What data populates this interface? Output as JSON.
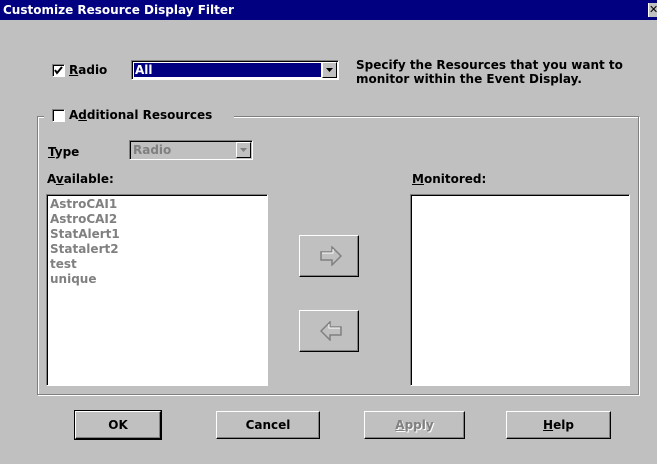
{
  "window": {
    "title": "Customize Resource Display Filter",
    "close_glyph": "✕"
  },
  "filter": {
    "radio_checkbox_checked": true,
    "radio_label_mnemonic": "R",
    "radio_label_rest": "adio",
    "radio_combo_value": "All",
    "instruction_line1": "Specify the Resources that you want to",
    "instruction_line2": "monitor within the Event Display."
  },
  "additional": {
    "checkbox_checked": false,
    "label_pre": "A",
    "label_mnemonic": "d",
    "label_rest": "ditional Resources",
    "type_label_mnemonic": "T",
    "type_label_rest": "ype",
    "type_value": "Radio",
    "available_label_pre": "A",
    "available_label_mnemonic": "v",
    "available_label_rest": "ailable:",
    "monitored_label_mnemonic": "M",
    "monitored_label_rest": "onitored:",
    "available_items": [
      "AstroCAI1",
      "AstroCAI2",
      "StatAlert1",
      "Statalert2",
      "test",
      "unique"
    ],
    "monitored_items": [],
    "add_icon": "right-arrow-icon",
    "remove_icon": "left-arrow-icon"
  },
  "buttons": {
    "ok": "OK",
    "cancel": "Cancel",
    "apply_mnemonic": "A",
    "apply_rest": "pply",
    "help_mnemonic": "H",
    "help_rest": "elp"
  },
  "colors": {
    "titlebar": "#000080",
    "face": "#c0c0c0",
    "disabled_text": "#808080"
  }
}
